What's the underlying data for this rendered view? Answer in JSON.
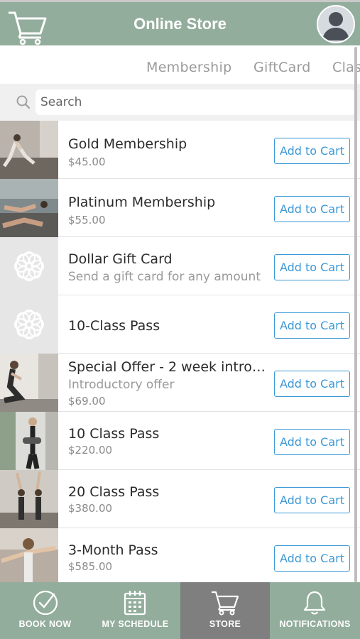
{
  "header": {
    "title": "Online Store"
  },
  "tabs": [
    {
      "label": "Membership"
    },
    {
      "label": "GiftCard"
    },
    {
      "label": "Clas"
    }
  ],
  "search": {
    "placeholder": "Search"
  },
  "products": [
    {
      "name": "Gold Membership",
      "price": "$45.00",
      "button": "Add to Cart"
    },
    {
      "name": "Platinum Membership",
      "price": "$55.00",
      "button": "Add to Cart"
    },
    {
      "name": "Dollar Gift Card",
      "description": "Send a gift card for any amount",
      "button": "Add to Cart"
    },
    {
      "name": "10-Class Pass",
      "button": "Add to Cart"
    },
    {
      "name": "Special Offer - 2 week intro p...",
      "description": "Introductory offer",
      "price": "$69.00",
      "button": "Add to Cart"
    },
    {
      "name": "10 Class Pass",
      "price": "$220.00",
      "button": "Add to Cart"
    },
    {
      "name": "20 Class Pass",
      "price": "$380.00",
      "button": "Add to Cart"
    },
    {
      "name": "3-Month Pass",
      "price": "$585.00",
      "button": "Add to Cart"
    }
  ],
  "nav": [
    {
      "label": "BOOK NOW",
      "icon": "check-circle-icon"
    },
    {
      "label": "MY SCHEDULE",
      "icon": "calendar-icon"
    },
    {
      "label": "STORE",
      "icon": "cart-icon",
      "active": true
    },
    {
      "label": "NOTIFICATIONS",
      "icon": "bell-icon"
    }
  ],
  "colors": {
    "header": "#93ad9c",
    "accent": "#3a98d6",
    "active_nav": "#7f7f7f"
  }
}
